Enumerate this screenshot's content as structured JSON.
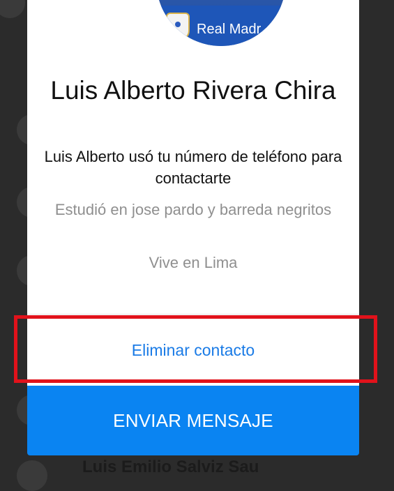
{
  "background": {
    "list_item_name": "Luis Emilio Salviz Sau"
  },
  "profile": {
    "photo_caption": "Real Madr",
    "name": "Luis Alberto Rivera Chira",
    "contact_info": "Luis Alberto usó tu número de teléfono para contactarte",
    "education": "Estudió en jose pardo y barreda negritos",
    "location": "Vive en Lima"
  },
  "actions": {
    "remove_contact_label": "Eliminar contacto",
    "send_message_label": "ENVIAR MENSAJE"
  },
  "colors": {
    "accent": "#0a84f2",
    "link": "#1a7be6",
    "highlight": "#e1121b"
  }
}
